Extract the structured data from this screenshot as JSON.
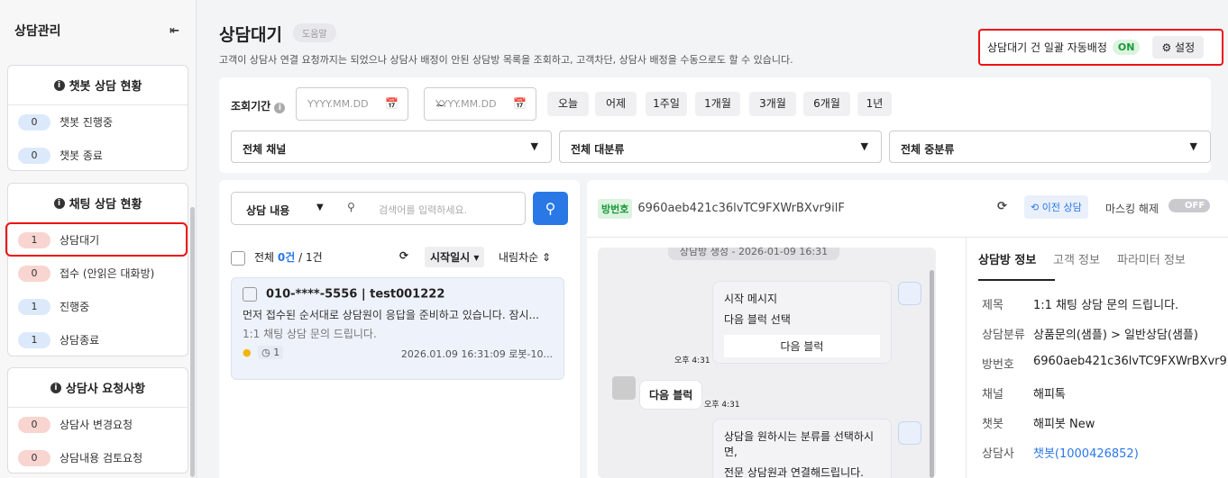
{
  "sidebar": {
    "title": "상담관리",
    "collapse_icon": "collapse-left-icon",
    "groups": [
      {
        "title": "챗봇 상담 현황",
        "items": [
          {
            "count": "0",
            "label": "챗봇 진행중"
          },
          {
            "count": "0",
            "label": "챗봇 종료"
          }
        ]
      },
      {
        "title": "채팅 상담 현황",
        "items": [
          {
            "count": "1",
            "label": "상담대기"
          },
          {
            "count": "0",
            "label": "접수 (안읽은 대화방)"
          },
          {
            "count": "1",
            "label": "진행중"
          },
          {
            "count": "1",
            "label": "상담종료"
          }
        ]
      },
      {
        "title": "상담사 요청사항",
        "items": [
          {
            "count": "0",
            "label": "상담사 변경요청"
          },
          {
            "count": "0",
            "label": "상담내용 검토요청"
          }
        ]
      }
    ]
  },
  "header": {
    "title": "상담대기",
    "help": "도움말",
    "description": "고객이 상담사 연결 요청까지는 되었으나 상담사 배정이 안된 상담방 목록을 조회하고, 고객차단, 상담사 배정을 수동으로도 할 수 있습니다.",
    "auto_label": "상담대기 건 일괄 자동배정",
    "auto_state": "ON",
    "settings_label": "설정"
  },
  "filter": {
    "period_label": "조회기간",
    "date_placeholder": "YYYY.MM.DD",
    "tilde": "~",
    "quick": [
      "오늘",
      "어제",
      "1주일",
      "1개월",
      "3개월",
      "6개월",
      "1년"
    ],
    "selects": [
      "전체 채널",
      "전체 대분류",
      "전체 중분류"
    ]
  },
  "list": {
    "search_type": "상담 내용",
    "search_placeholder": "검색어를 입력하세요.",
    "total_label": "전체",
    "selected": "0건",
    "total": "/ 1건",
    "sort_field": "시작일시",
    "sort_order": "내림차순",
    "items": [
      {
        "title": "010-****-5556 | test001222",
        "preview": "먼저 접수된 순서대로 상담원이 응답을 준비하고 있습니다. 잠시...",
        "subject": "1:1 채팅 상담 문의 드립니다.",
        "timer": "1",
        "datetime": "2026.01.09 16:31:09",
        "agent": "로봇-10..."
      }
    ]
  },
  "chat": {
    "room_badge": "방번호",
    "room_id": "6960aeb421c36lvTC9FXWrBXvr9ilF",
    "prev_label": "이전 상담",
    "mask_label": "마스킹 해제",
    "mask_state": "OFF",
    "created": "상담방 생성 - 2026-01-09 16:31",
    "messages": {
      "m1_line1": "시작 메시지",
      "m1_line2": "다음 블럭 선택",
      "m1_button": "다음 블럭",
      "m1_time": "오후 4:31",
      "m2_text": "다음 블럭",
      "m2_time": "오후 4:31",
      "m3_line1": "상담을 원하시는 분류를 선택하시면,",
      "m3_line2": "전문 상담원과 연결해드립니다."
    }
  },
  "info": {
    "tabs": [
      "상담방 정보",
      "고객 정보",
      "파라미터 정보"
    ],
    "rows": [
      {
        "k": "제목",
        "v": "1:1 채팅 상담 문의 드립니다."
      },
      {
        "k": "상담분류",
        "v": "상품문의(샘플) > 일반상담(샘플)"
      },
      {
        "k": "방번호",
        "v": "6960aeb421c36lvTC9FXWrBXvr9..."
      },
      {
        "k": "채널",
        "v": "해피톡"
      },
      {
        "k": "챗봇",
        "v": "해피봇 New"
      },
      {
        "k": "상담사",
        "v": "챗봇(1000426852)"
      }
    ]
  }
}
